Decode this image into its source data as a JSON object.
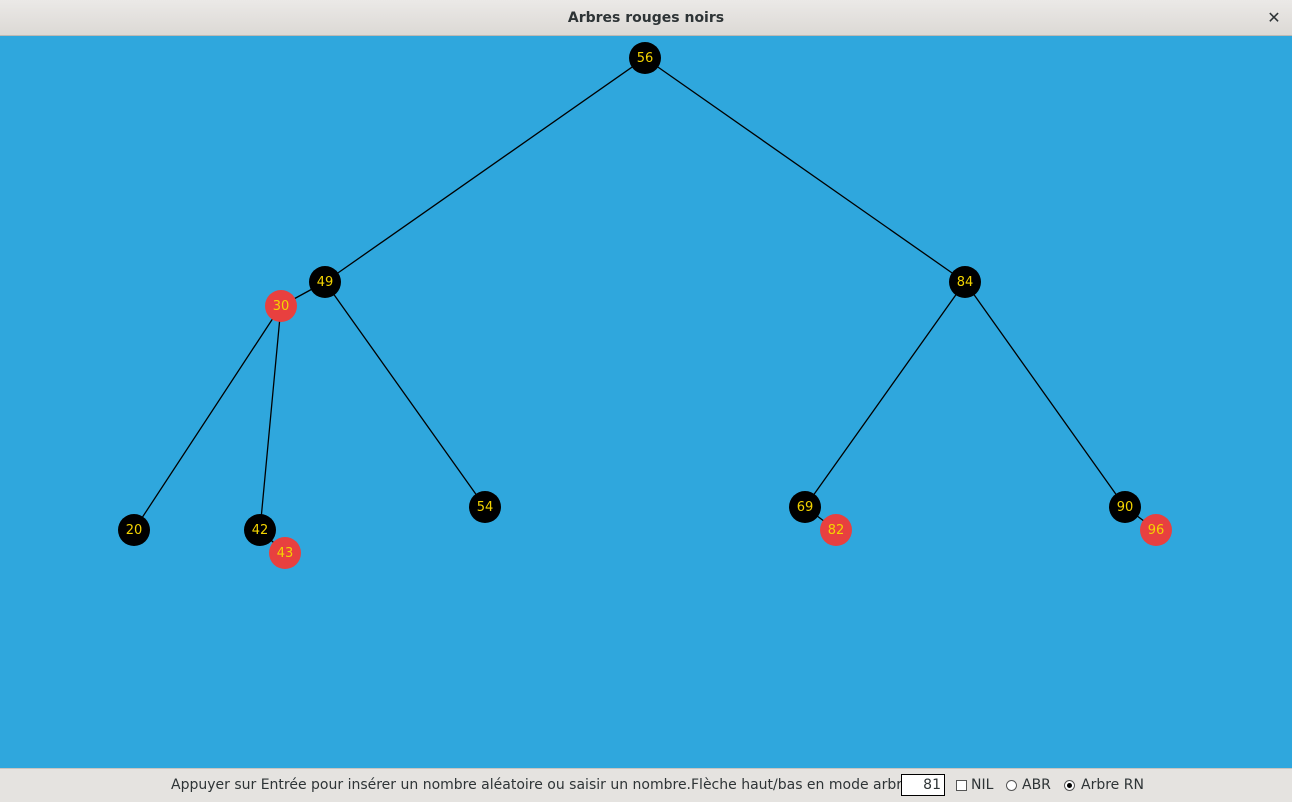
{
  "window": {
    "title": "Arbres rouges noirs"
  },
  "tree": {
    "nodes": [
      {
        "id": "n56",
        "value": "56",
        "color": "black"
      },
      {
        "id": "n49",
        "value": "49",
        "color": "black"
      },
      {
        "id": "n84",
        "value": "84",
        "color": "black"
      },
      {
        "id": "n30",
        "value": "30",
        "color": "red"
      },
      {
        "id": "n20",
        "value": "20",
        "color": "black"
      },
      {
        "id": "n42",
        "value": "42",
        "color": "black"
      },
      {
        "id": "n43",
        "value": "43",
        "color": "red"
      },
      {
        "id": "n54",
        "value": "54",
        "color": "black"
      },
      {
        "id": "n69",
        "value": "69",
        "color": "black"
      },
      {
        "id": "n82",
        "value": "82",
        "color": "red"
      },
      {
        "id": "n90",
        "value": "90",
        "color": "black"
      },
      {
        "id": "n96",
        "value": "96",
        "color": "red"
      }
    ],
    "edges": [
      [
        "n56",
        "n49"
      ],
      [
        "n56",
        "n84"
      ],
      [
        "n49",
        "n30"
      ],
      [
        "n49",
        "n54"
      ],
      [
        "n30",
        "n20"
      ],
      [
        "n30",
        "n42"
      ],
      [
        "n42",
        "n43"
      ],
      [
        "n84",
        "n69"
      ],
      [
        "n84",
        "n90"
      ],
      [
        "n69",
        "n82"
      ],
      [
        "n90",
        "n96"
      ]
    ],
    "colors": {
      "background": "#2fa7dd",
      "black_node": "#000000",
      "red_node": "#e8403f",
      "node_text": "#f4d400"
    }
  },
  "controls": {
    "hint": "Appuyer sur Entrée pour insérer un nombre aléatoire ou saisir un nombre.Flèche haut/bas en mode arbre RN.",
    "input_value": "81",
    "nil_label": "NIL",
    "nil_checked": false,
    "abr_label": "ABR",
    "rn_label": "Arbre RN",
    "selected_mode": "Arbre RN"
  },
  "icons": {
    "close": "close-icon"
  }
}
